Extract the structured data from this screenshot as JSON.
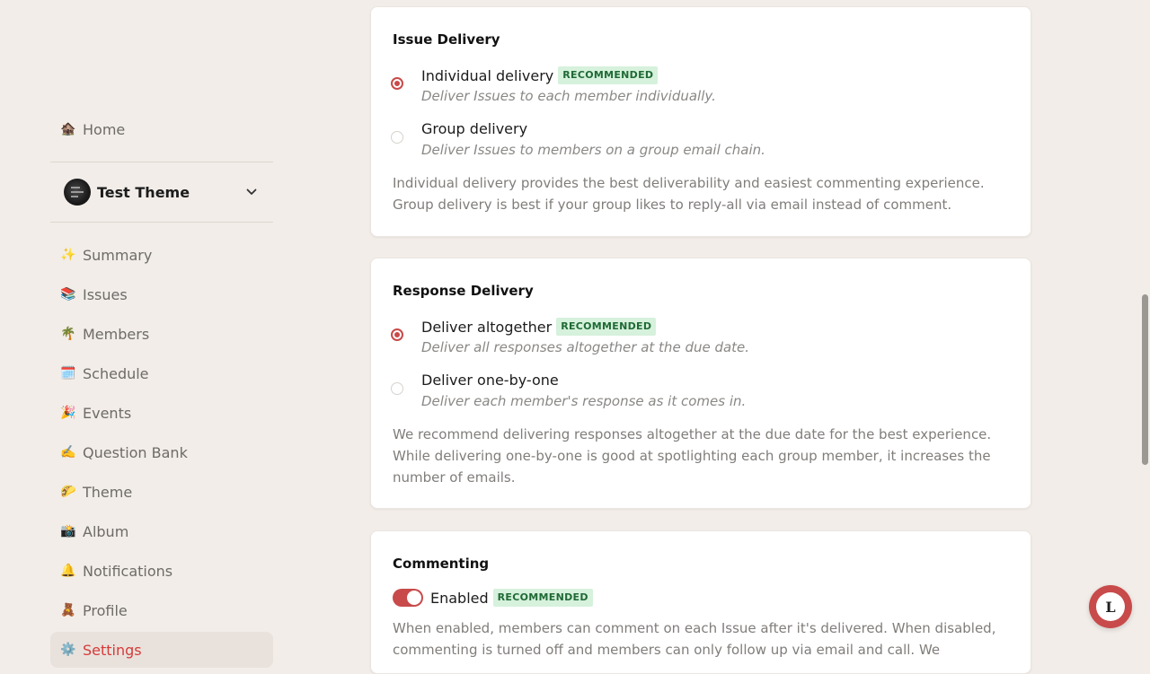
{
  "sidebar": {
    "home": {
      "icon": "🏚️",
      "label": "Home"
    },
    "group": {
      "name": "Test Theme"
    },
    "items": [
      {
        "icon": "✨",
        "label": "Summary"
      },
      {
        "icon": "📚",
        "label": "Issues"
      },
      {
        "icon": "🌴",
        "label": "Members"
      },
      {
        "icon": "🗓️",
        "label": "Schedule"
      },
      {
        "icon": "🎉",
        "label": "Events"
      },
      {
        "icon": "✍️",
        "label": "Question Bank"
      },
      {
        "icon": "🌮",
        "label": "Theme"
      },
      {
        "icon": "📸",
        "label": "Album"
      },
      {
        "icon": "🔔",
        "label": "Notifications"
      },
      {
        "icon": "🧸",
        "label": "Profile"
      },
      {
        "icon": "⚙️",
        "label": "Settings"
      }
    ]
  },
  "issue_delivery": {
    "title": "Issue Delivery",
    "options": [
      {
        "title": "Individual delivery",
        "badge": "RECOMMENDED",
        "desc": "Deliver Issues to each member individually.",
        "selected": true
      },
      {
        "title": "Group delivery",
        "desc": "Deliver Issues to members on a group email chain.",
        "selected": false
      }
    ],
    "help": "Individual delivery provides the best deliverability and easiest commenting experience. Group delivery is best if your group likes to reply-all via email instead of comment."
  },
  "response_delivery": {
    "title": "Response Delivery",
    "options": [
      {
        "title": "Deliver altogether",
        "badge": "RECOMMENDED",
        "desc": "Deliver all responses altogether at the due date.",
        "selected": true
      },
      {
        "title": "Deliver one-by-one",
        "desc": "Deliver each member's response as it comes in.",
        "selected": false
      }
    ],
    "help": "We recommend delivering responses altogether at the due date for the best experience. While delivering one-by-one is good at spotlighting each group member, it increases the number of emails."
  },
  "commenting": {
    "title": "Commenting",
    "toggle_label": "Enabled",
    "badge": "RECOMMENDED",
    "enabled": true,
    "help": "When enabled, members can comment on each Issue after it's delivered. When disabled, commenting is turned off and members can only follow up via email and call. We"
  },
  "fab": {
    "letter": "L"
  },
  "colors": {
    "accent": "#c84a4a",
    "background": "#f2ede8",
    "badge_bg": "#d6f1dc",
    "badge_text": "#1f6a35",
    "active_text": "#d53a3a"
  }
}
